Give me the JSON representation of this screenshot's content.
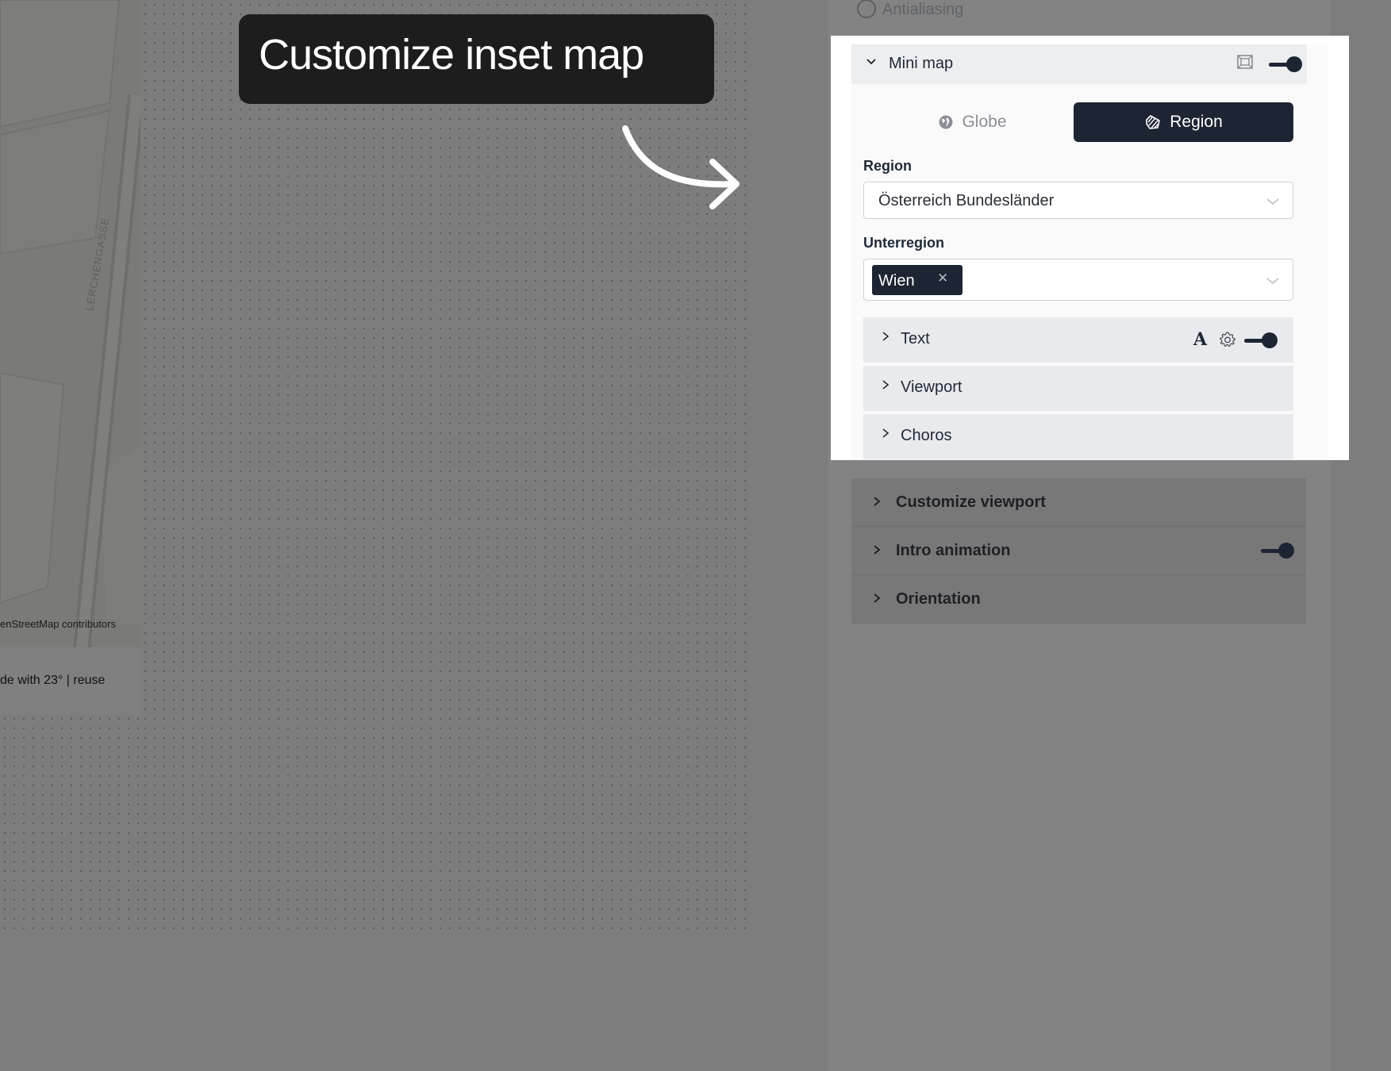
{
  "map": {
    "street_name": "LERCHENGASSE",
    "attribution": "enStreetMap contributors",
    "credit": "de with 23° | reuse"
  },
  "callout": {
    "text": "Customize inset map"
  },
  "panel": {
    "antialiasing_label": "Antialiasing",
    "mini_map": {
      "title": "Mini map",
      "enabled": true,
      "mode_options": [
        "Globe",
        "Region"
      ],
      "selected_mode": "Region",
      "region_label": "Region",
      "region_value": "Österreich Bundesländer",
      "subregion_label": "Unterregion",
      "subregion_chips": [
        "Wien"
      ],
      "subsections": [
        {
          "label": "Text",
          "enabled": true
        },
        {
          "label": "Viewport"
        },
        {
          "label": "Choros"
        }
      ]
    },
    "sections": [
      {
        "label": "Customize viewport"
      },
      {
        "label": "Intro animation",
        "enabled": true
      },
      {
        "label": "Orientation"
      }
    ]
  },
  "colors": {
    "dark_accent": "#1d2533",
    "overlay_gray": "#7d7d7d",
    "highlight_bg": "#ffffff"
  },
  "icons": {
    "collapse": "chevron-down-icon",
    "expand": "chevron-right-icon",
    "minimap_frame": "frame-icon",
    "globe": "globe-icon",
    "region": "region-hatch-icon",
    "dropdown": "chevron-down-icon",
    "remove_chip": "close-icon",
    "font": "font-icon",
    "settings": "gear-icon",
    "callout_arrow": "curved-arrow-icon"
  }
}
